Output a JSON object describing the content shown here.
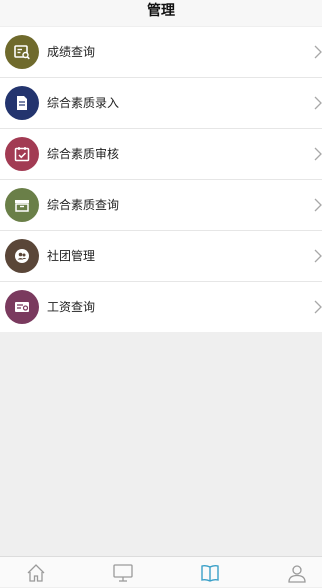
{
  "header": {
    "title": "管理"
  },
  "menu": {
    "items": [
      {
        "label": "成绩查询",
        "icon": "score-search-icon",
        "color": "#6f6a2c"
      },
      {
        "label": "综合素质录入",
        "icon": "document-entry-icon",
        "color": "#23346e"
      },
      {
        "label": "综合素质审核",
        "icon": "calendar-check-icon",
        "color": "#a23b53"
      },
      {
        "label": "综合素质查询",
        "icon": "archive-box-icon",
        "color": "#6a7f48"
      },
      {
        "label": "社团管理",
        "icon": "group-people-icon",
        "color": "#5a4638"
      },
      {
        "label": "工资查询",
        "icon": "salary-card-icon",
        "color": "#7a3a5e"
      }
    ]
  },
  "tabbar": {
    "tabs": [
      {
        "name": "home-tab",
        "icon": "house-icon",
        "active": false
      },
      {
        "name": "monitor-tab",
        "icon": "monitor-icon",
        "active": false
      },
      {
        "name": "manage-tab",
        "icon": "book-icon",
        "active": true
      },
      {
        "name": "profile-tab",
        "icon": "person-icon",
        "active": false
      }
    ],
    "active_color": "#3aa0c8",
    "inactive_color": "#9a9a9a"
  }
}
